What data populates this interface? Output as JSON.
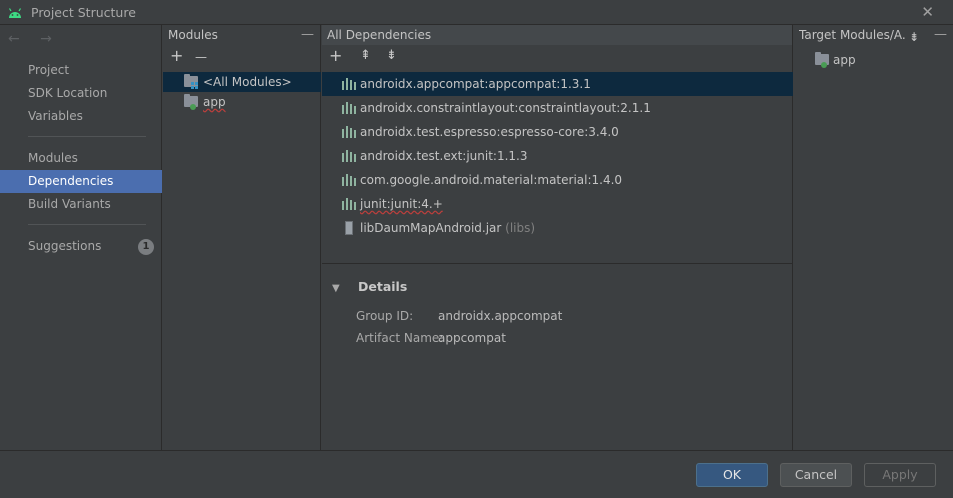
{
  "window": {
    "title": "Project Structure",
    "close_glyph": "✕",
    "icon": "android-icon"
  },
  "nav": {
    "back_forward": "← →",
    "items": [
      {
        "label": "Project"
      },
      {
        "label": "SDK Location"
      },
      {
        "label": "Variables"
      },
      {
        "label": "Modules"
      },
      {
        "label": "Dependencies",
        "selected": true
      },
      {
        "label": "Build Variants"
      },
      {
        "label": "Suggestions",
        "badge": "1"
      }
    ]
  },
  "modules_panel": {
    "title": "Modules",
    "minimize_glyph": "—",
    "add_glyph": "+",
    "remove_glyph": "—",
    "rows": [
      {
        "label": "<All Modules>",
        "selected": true
      },
      {
        "label": "app"
      }
    ]
  },
  "deps_panel": {
    "title": "All Dependencies",
    "add_glyph": "+",
    "expand_glyph": "⇞",
    "collapse_glyph": "⇟",
    "rows": [
      {
        "label": "androidx.appcompat:appcompat:1.3.1",
        "selected": true
      },
      {
        "label": "androidx.constraintlayout:constraintlayout:2.1.1"
      },
      {
        "label": "androidx.test.espresso:espresso-core:3.4.0"
      },
      {
        "label": "androidx.test.ext:junit:1.1.3"
      },
      {
        "label": "com.google.android.material:material:1.4.0"
      },
      {
        "label": "junit:junit:4.+"
      },
      {
        "label": "libDaumMapAndroid.jar",
        "suffix": "(libs)"
      }
    ],
    "details": {
      "title": "Details",
      "toggle_glyph": "▼",
      "group_label": "Group ID:",
      "group_value": "androidx.appcompat",
      "artifact_label": "Artifact Name:",
      "artifact_value": "appcompat"
    }
  },
  "target_panel": {
    "title": "Target Modules/A...",
    "collapse_glyph": "⇟",
    "minimize_glyph": "—",
    "rows": [
      {
        "label": "app"
      }
    ]
  },
  "buttons": {
    "ok": "OK",
    "cancel": "Cancel",
    "apply": "Apply"
  },
  "colors": {
    "accent": "#4b6eaf",
    "selection": "#0d293e",
    "ok_button": "#365880"
  }
}
